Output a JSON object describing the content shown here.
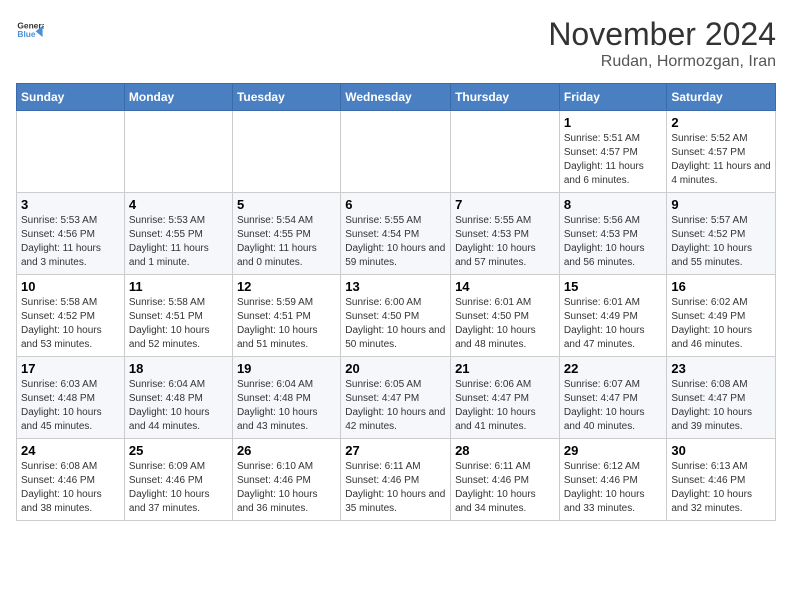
{
  "header": {
    "logo_general": "General",
    "logo_blue": "Blue",
    "month": "November 2024",
    "location": "Rudan, Hormozgan, Iran"
  },
  "weekdays": [
    "Sunday",
    "Monday",
    "Tuesday",
    "Wednesday",
    "Thursday",
    "Friday",
    "Saturday"
  ],
  "weeks": [
    [
      {
        "day": "",
        "info": ""
      },
      {
        "day": "",
        "info": ""
      },
      {
        "day": "",
        "info": ""
      },
      {
        "day": "",
        "info": ""
      },
      {
        "day": "",
        "info": ""
      },
      {
        "day": "1",
        "info": "Sunrise: 5:51 AM\nSunset: 4:57 PM\nDaylight: 11 hours and 6 minutes."
      },
      {
        "day": "2",
        "info": "Sunrise: 5:52 AM\nSunset: 4:57 PM\nDaylight: 11 hours and 4 minutes."
      }
    ],
    [
      {
        "day": "3",
        "info": "Sunrise: 5:53 AM\nSunset: 4:56 PM\nDaylight: 11 hours and 3 minutes."
      },
      {
        "day": "4",
        "info": "Sunrise: 5:53 AM\nSunset: 4:55 PM\nDaylight: 11 hours and 1 minute."
      },
      {
        "day": "5",
        "info": "Sunrise: 5:54 AM\nSunset: 4:55 PM\nDaylight: 11 hours and 0 minutes."
      },
      {
        "day": "6",
        "info": "Sunrise: 5:55 AM\nSunset: 4:54 PM\nDaylight: 10 hours and 59 minutes."
      },
      {
        "day": "7",
        "info": "Sunrise: 5:55 AM\nSunset: 4:53 PM\nDaylight: 10 hours and 57 minutes."
      },
      {
        "day": "8",
        "info": "Sunrise: 5:56 AM\nSunset: 4:53 PM\nDaylight: 10 hours and 56 minutes."
      },
      {
        "day": "9",
        "info": "Sunrise: 5:57 AM\nSunset: 4:52 PM\nDaylight: 10 hours and 55 minutes."
      }
    ],
    [
      {
        "day": "10",
        "info": "Sunrise: 5:58 AM\nSunset: 4:52 PM\nDaylight: 10 hours and 53 minutes."
      },
      {
        "day": "11",
        "info": "Sunrise: 5:58 AM\nSunset: 4:51 PM\nDaylight: 10 hours and 52 minutes."
      },
      {
        "day": "12",
        "info": "Sunrise: 5:59 AM\nSunset: 4:51 PM\nDaylight: 10 hours and 51 minutes."
      },
      {
        "day": "13",
        "info": "Sunrise: 6:00 AM\nSunset: 4:50 PM\nDaylight: 10 hours and 50 minutes."
      },
      {
        "day": "14",
        "info": "Sunrise: 6:01 AM\nSunset: 4:50 PM\nDaylight: 10 hours and 48 minutes."
      },
      {
        "day": "15",
        "info": "Sunrise: 6:01 AM\nSunset: 4:49 PM\nDaylight: 10 hours and 47 minutes."
      },
      {
        "day": "16",
        "info": "Sunrise: 6:02 AM\nSunset: 4:49 PM\nDaylight: 10 hours and 46 minutes."
      }
    ],
    [
      {
        "day": "17",
        "info": "Sunrise: 6:03 AM\nSunset: 4:48 PM\nDaylight: 10 hours and 45 minutes."
      },
      {
        "day": "18",
        "info": "Sunrise: 6:04 AM\nSunset: 4:48 PM\nDaylight: 10 hours and 44 minutes."
      },
      {
        "day": "19",
        "info": "Sunrise: 6:04 AM\nSunset: 4:48 PM\nDaylight: 10 hours and 43 minutes."
      },
      {
        "day": "20",
        "info": "Sunrise: 6:05 AM\nSunset: 4:47 PM\nDaylight: 10 hours and 42 minutes."
      },
      {
        "day": "21",
        "info": "Sunrise: 6:06 AM\nSunset: 4:47 PM\nDaylight: 10 hours and 41 minutes."
      },
      {
        "day": "22",
        "info": "Sunrise: 6:07 AM\nSunset: 4:47 PM\nDaylight: 10 hours and 40 minutes."
      },
      {
        "day": "23",
        "info": "Sunrise: 6:08 AM\nSunset: 4:47 PM\nDaylight: 10 hours and 39 minutes."
      }
    ],
    [
      {
        "day": "24",
        "info": "Sunrise: 6:08 AM\nSunset: 4:46 PM\nDaylight: 10 hours and 38 minutes."
      },
      {
        "day": "25",
        "info": "Sunrise: 6:09 AM\nSunset: 4:46 PM\nDaylight: 10 hours and 37 minutes."
      },
      {
        "day": "26",
        "info": "Sunrise: 6:10 AM\nSunset: 4:46 PM\nDaylight: 10 hours and 36 minutes."
      },
      {
        "day": "27",
        "info": "Sunrise: 6:11 AM\nSunset: 4:46 PM\nDaylight: 10 hours and 35 minutes."
      },
      {
        "day": "28",
        "info": "Sunrise: 6:11 AM\nSunset: 4:46 PM\nDaylight: 10 hours and 34 minutes."
      },
      {
        "day": "29",
        "info": "Sunrise: 6:12 AM\nSunset: 4:46 PM\nDaylight: 10 hours and 33 minutes."
      },
      {
        "day": "30",
        "info": "Sunrise: 6:13 AM\nSunset: 4:46 PM\nDaylight: 10 hours and 32 minutes."
      }
    ]
  ]
}
